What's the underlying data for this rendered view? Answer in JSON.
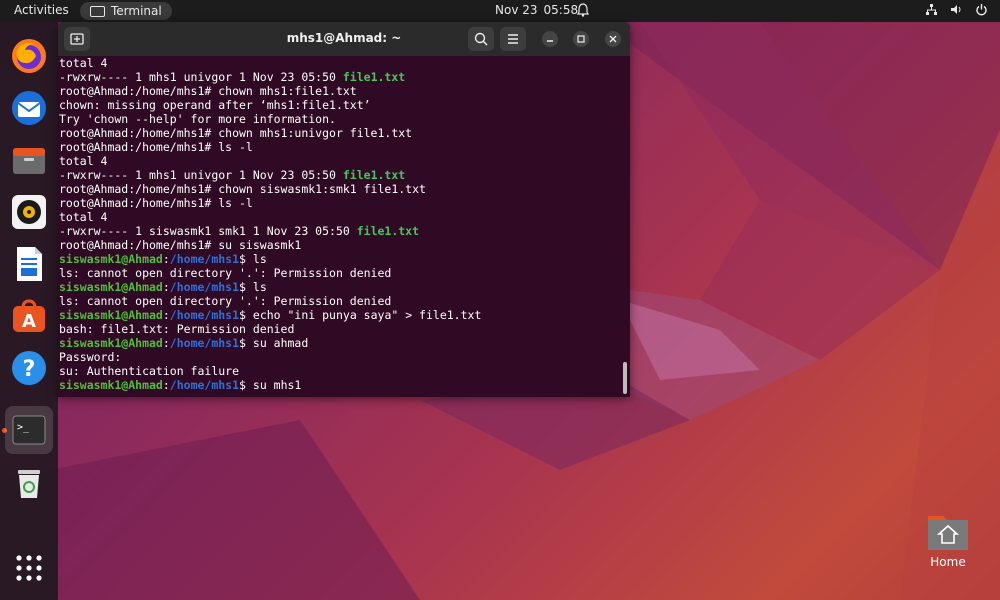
{
  "topbar": {
    "activities": "Activities",
    "app_name": "Terminal",
    "date": "Nov 23",
    "time": "05:58"
  },
  "dock": {
    "items": [
      "firefox",
      "thunderbird",
      "files",
      "rhythmbox",
      "writer",
      "app-center",
      "help",
      "terminal",
      "trash",
      "app-grid"
    ]
  },
  "terminal": {
    "title": "mhs1@Ahmad: ~",
    "lines": [
      {
        "plain": "total 4"
      },
      {
        "plain": "-rwxrw---- 1 mhs1 univgor 1 Nov 23 05:50 ",
        "file": "file1.txt"
      },
      {
        "plain": "root@Ahmad:/home/mhs1# chown mhs1:file1.txt"
      },
      {
        "plain": "chown: missing operand after ‘mhs1:file1.txt’"
      },
      {
        "plain": "Try 'chown --help' for more information."
      },
      {
        "plain": "root@Ahmad:/home/mhs1# chown mhs1:univgor file1.txt"
      },
      {
        "plain": "root@Ahmad:/home/mhs1# ls -l"
      },
      {
        "plain": "total 4"
      },
      {
        "plain": "-rwxrw---- 1 mhs1 univgor 1 Nov 23 05:50 ",
        "file": "file1.txt"
      },
      {
        "plain": "root@Ahmad:/home/mhs1# chown siswasmk1:smk1 file1.txt"
      },
      {
        "plain": "root@Ahmad:/home/mhs1# ls -l"
      },
      {
        "plain": "total 4"
      },
      {
        "plain": "-rwxrw---- 1 siswasmk1 smk1 1 Nov 23 05:50 ",
        "file": "file1.txt"
      },
      {
        "plain": "root@Ahmad:/home/mhs1# su siswasmk1"
      },
      {
        "user": "siswasmk1@Ahmad",
        "path": "/home/mhs1",
        "cmd": "$ ls"
      },
      {
        "plain": "ls: cannot open directory '.': Permission denied"
      },
      {
        "user": "siswasmk1@Ahmad",
        "path": "/home/mhs1",
        "cmd": "$ ls"
      },
      {
        "plain": "ls: cannot open directory '.': Permission denied"
      },
      {
        "user": "siswasmk1@Ahmad",
        "path": "/home/mhs1",
        "cmd": "$ echo \"ini punya saya\" > file1.txt"
      },
      {
        "plain": "bash: file1.txt: Permission denied"
      },
      {
        "user": "siswasmk1@Ahmad",
        "path": "/home/mhs1",
        "cmd": "$ su ahmad"
      },
      {
        "plain": "Password:"
      },
      {
        "plain": "su: Authentication failure"
      },
      {
        "user": "siswasmk1@Ahmad",
        "path": "/home/mhs1",
        "cmd": "$ su mhs1"
      }
    ]
  },
  "desktop": {
    "home_label": "Home"
  },
  "colors": {
    "terminal_bg": "#300a24",
    "prompt_user": "#4fbf3a",
    "prompt_path": "#2e6fd8",
    "file_name": "#44c95a",
    "accent": "#e95420"
  }
}
